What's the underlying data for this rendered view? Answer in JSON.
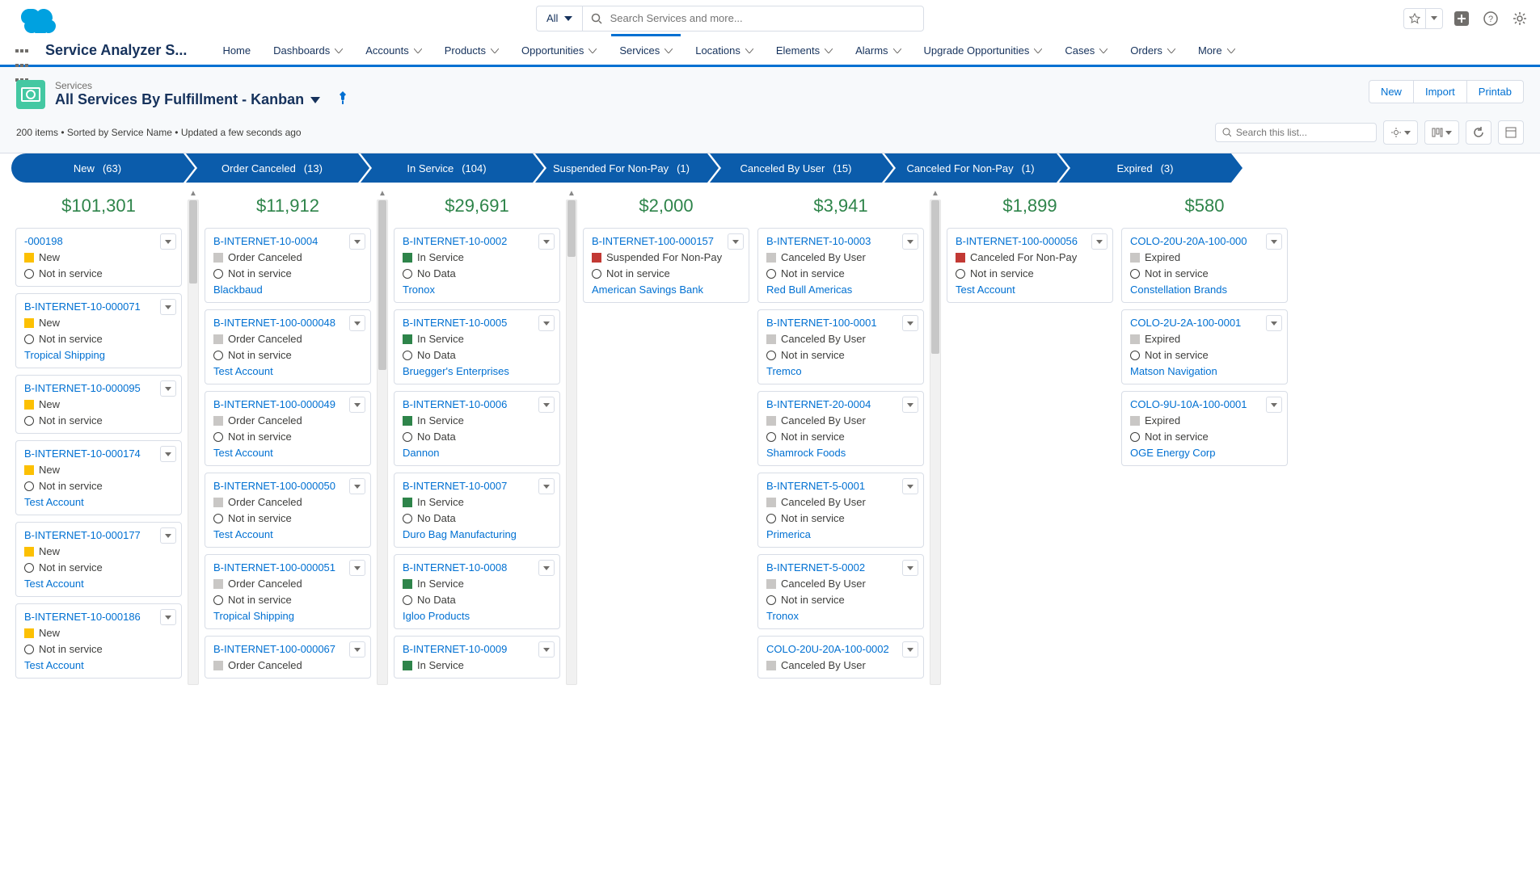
{
  "topbar": {
    "search_type": "All",
    "search_placeholder": "Search Services and more..."
  },
  "nav": {
    "app_name": "Service Analyzer S...",
    "items": [
      "Home",
      "Dashboards",
      "Accounts",
      "Products",
      "Opportunities",
      "Services",
      "Locations",
      "Elements",
      "Alarms",
      "Upgrade Opportunities",
      "Cases",
      "Orders",
      "More"
    ],
    "active_index": 5
  },
  "header": {
    "object_label": "Services",
    "view_title": "All Services By Fulfillment - Kanban",
    "meta": "200 items • Sorted by Service Name • Updated a few seconds ago",
    "actions": [
      "New",
      "Import",
      "Printab"
    ],
    "list_search_placeholder": "Search this list..."
  },
  "stages": [
    {
      "name": "New",
      "count": "(63)",
      "total": "$101,301"
    },
    {
      "name": "Order Canceled",
      "count": "(13)",
      "total": "$11,912"
    },
    {
      "name": "In Service",
      "count": "(104)",
      "total": "$29,691"
    },
    {
      "name": "Suspended For Non-Pay",
      "count": "(1)",
      "total": "$2,000"
    },
    {
      "name": "Canceled By User",
      "count": "(15)",
      "total": "$3,941"
    },
    {
      "name": "Canceled For Non-Pay",
      "count": "(1)",
      "total": "$1,899"
    },
    {
      "name": "Expired",
      "count": "(3)",
      "total": "$580"
    }
  ],
  "columns": [
    {
      "scroll": true,
      "thumb_top": 0,
      "thumb_h": 103,
      "cards": [
        {
          "name": "-000198",
          "status": "New",
          "color": "c-yellow",
          "sub": "Not in service",
          "acct": ""
        },
        {
          "name": "B-INTERNET-10-000071",
          "status": "New",
          "color": "c-yellow",
          "sub": "Not in service",
          "acct": "Tropical Shipping"
        },
        {
          "name": "B-INTERNET-10-000095",
          "status": "New",
          "color": "c-yellow",
          "sub": "Not in service",
          "acct": ""
        },
        {
          "name": "B-INTERNET-10-000174",
          "status": "New",
          "color": "c-yellow",
          "sub": "Not in service",
          "acct": "Test Account"
        },
        {
          "name": "B-INTERNET-10-000177",
          "status": "New",
          "color": "c-yellow",
          "sub": "Not in service",
          "acct": "Test Account"
        },
        {
          "name": "B-INTERNET-10-000186",
          "status": "New",
          "color": "c-yellow",
          "sub": "Not in service",
          "acct": "Test Account"
        }
      ]
    },
    {
      "scroll": true,
      "thumb_top": 0,
      "thumb_h": 210,
      "cards": [
        {
          "name": "B-INTERNET-10-0004",
          "status": "Order Canceled",
          "color": "c-grey",
          "sub": "Not in service",
          "acct": "Blackbaud"
        },
        {
          "name": "B-INTERNET-100-000048",
          "status": "Order Canceled",
          "color": "c-grey",
          "sub": "Not in service",
          "acct": "Test Account"
        },
        {
          "name": "B-INTERNET-100-000049",
          "status": "Order Canceled",
          "color": "c-grey",
          "sub": "Not in service",
          "acct": "Test Account"
        },
        {
          "name": "B-INTERNET-100-000050",
          "status": "Order Canceled",
          "color": "c-grey",
          "sub": "Not in service",
          "acct": "Test Account"
        },
        {
          "name": "B-INTERNET-100-000051",
          "status": "Order Canceled",
          "color": "c-grey",
          "sub": "Not in service",
          "acct": "Tropical Shipping"
        },
        {
          "name": "B-INTERNET-100-000067",
          "status": "Order Canceled",
          "color": "c-grey",
          "sub": "",
          "acct": ""
        }
      ]
    },
    {
      "scroll": true,
      "thumb_top": 0,
      "thumb_h": 70,
      "cards": [
        {
          "name": "B-INTERNET-10-0002",
          "status": "In Service",
          "color": "c-green",
          "sub": "No Data",
          "acct": "Tronox"
        },
        {
          "name": "B-INTERNET-10-0005",
          "status": "In Service",
          "color": "c-green",
          "sub": "No Data",
          "acct": "Bruegger's Enterprises"
        },
        {
          "name": "B-INTERNET-10-0006",
          "status": "In Service",
          "color": "c-green",
          "sub": "No Data",
          "acct": "Dannon"
        },
        {
          "name": "B-INTERNET-10-0007",
          "status": "In Service",
          "color": "c-green",
          "sub": "No Data",
          "acct": "Duro Bag Manufacturing"
        },
        {
          "name": "B-INTERNET-10-0008",
          "status": "In Service",
          "color": "c-green",
          "sub": "No Data",
          "acct": "Igloo Products"
        },
        {
          "name": "B-INTERNET-10-0009",
          "status": "In Service",
          "color": "c-green",
          "sub": "",
          "acct": ""
        }
      ]
    },
    {
      "scroll": false,
      "cards": [
        {
          "name": "B-INTERNET-100-000157",
          "status": "Suspended For Non-Pay",
          "color": "c-red",
          "sub": "Not in service",
          "acct": "American Savings Bank"
        }
      ]
    },
    {
      "scroll": true,
      "thumb_top": 0,
      "thumb_h": 190,
      "cards": [
        {
          "name": "B-INTERNET-10-0003",
          "status": "Canceled By User",
          "color": "c-grey",
          "sub": "Not in service",
          "acct": "Red Bull Americas"
        },
        {
          "name": "B-INTERNET-100-0001",
          "status": "Canceled By User",
          "color": "c-grey",
          "sub": "Not in service",
          "acct": "Tremco"
        },
        {
          "name": "B-INTERNET-20-0004",
          "status": "Canceled By User",
          "color": "c-grey",
          "sub": "Not in service",
          "acct": "Shamrock Foods"
        },
        {
          "name": "B-INTERNET-5-0001",
          "status": "Canceled By User",
          "color": "c-grey",
          "sub": "Not in service",
          "acct": "Primerica"
        },
        {
          "name": "B-INTERNET-5-0002",
          "status": "Canceled By User",
          "color": "c-grey",
          "sub": "Not in service",
          "acct": "Tronox"
        },
        {
          "name": "COLO-20U-20A-100-0002",
          "status": "Canceled By User",
          "color": "c-grey",
          "sub": "",
          "acct": ""
        }
      ]
    },
    {
      "scroll": false,
      "cards": [
        {
          "name": "B-INTERNET-100-000056",
          "status": "Canceled For Non-Pay",
          "color": "c-red",
          "sub": "Not in service",
          "acct": "Test Account"
        }
      ]
    },
    {
      "scroll": false,
      "cards": [
        {
          "name": "COLO-20U-20A-100-000",
          "status": "Expired",
          "color": "c-grey",
          "sub": "Not in service",
          "acct": "Constellation Brands"
        },
        {
          "name": "COLO-2U-2A-100-0001",
          "status": "Expired",
          "color": "c-grey",
          "sub": "Not in service",
          "acct": "Matson Navigation"
        },
        {
          "name": "COLO-9U-10A-100-0001",
          "status": "Expired",
          "color": "c-grey",
          "sub": "Not in service",
          "acct": "OGE Energy Corp"
        }
      ]
    }
  ]
}
